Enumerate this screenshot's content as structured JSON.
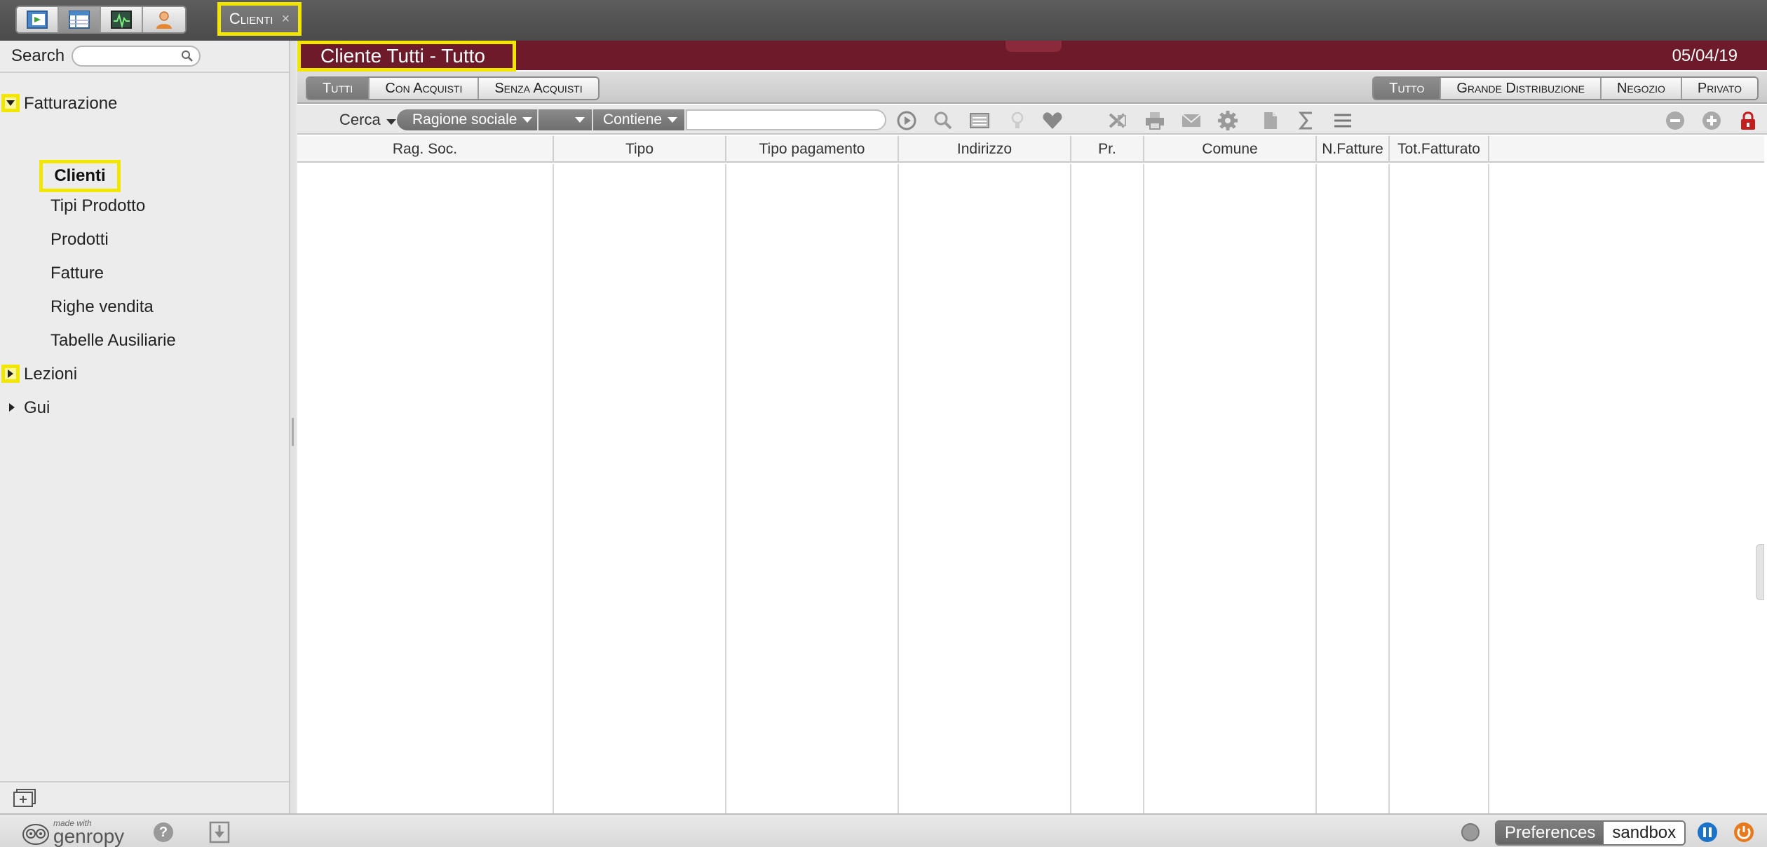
{
  "topbar": {
    "apps": [
      {
        "icon": "open-page-icon"
      },
      {
        "icon": "table-view-icon"
      },
      {
        "icon": "monitor-icon"
      },
      {
        "icon": "user-icon"
      }
    ],
    "open_tab": {
      "label": "Clienti",
      "close_glyph": "×"
    }
  },
  "sidebar": {
    "search_label": "Search",
    "search_placeholder": "",
    "tree": [
      {
        "label": "Fatturazione",
        "expanded": true
      },
      {
        "label": "Clienti"
      },
      {
        "label": "Tipi Prodotto"
      },
      {
        "label": "Prodotti"
      },
      {
        "label": "Fatture"
      },
      {
        "label": "Righe vendita"
      },
      {
        "label": "Tabelle Ausiliarie"
      },
      {
        "label": "Lezioni",
        "expanded": false
      },
      {
        "label": "Gui",
        "expanded": false
      }
    ]
  },
  "main": {
    "title": "Cliente Tutti - Tutto",
    "date": "05/04/19",
    "left_tabs": [
      "Tutti",
      "Con Acquisti",
      "Senza Acquisti"
    ],
    "right_tabs": [
      "Tutto",
      "Grande Distribuzione",
      "Negozio",
      "Privato"
    ],
    "query": {
      "cerca_label": "Cerca",
      "field": "Ragione sociale",
      "operator_blank": "",
      "condition": "Contiene",
      "value": ""
    },
    "columns": [
      "Rag. Soc.",
      "Tipo",
      "Tipo pagamento",
      "Indirizzo",
      "Pr.",
      "Comune",
      "N.Fatture",
      "Tot.Fatturato"
    ]
  },
  "footer": {
    "made_with": "made with",
    "brand": "genropy",
    "preferences_label": "Preferences",
    "env_label": "sandbox"
  },
  "colors": {
    "title_bar": "#6d1a2a",
    "highlight": "#f2e600",
    "accent_blue": "#1a73c8",
    "accent_orange": "#e87a1e"
  }
}
